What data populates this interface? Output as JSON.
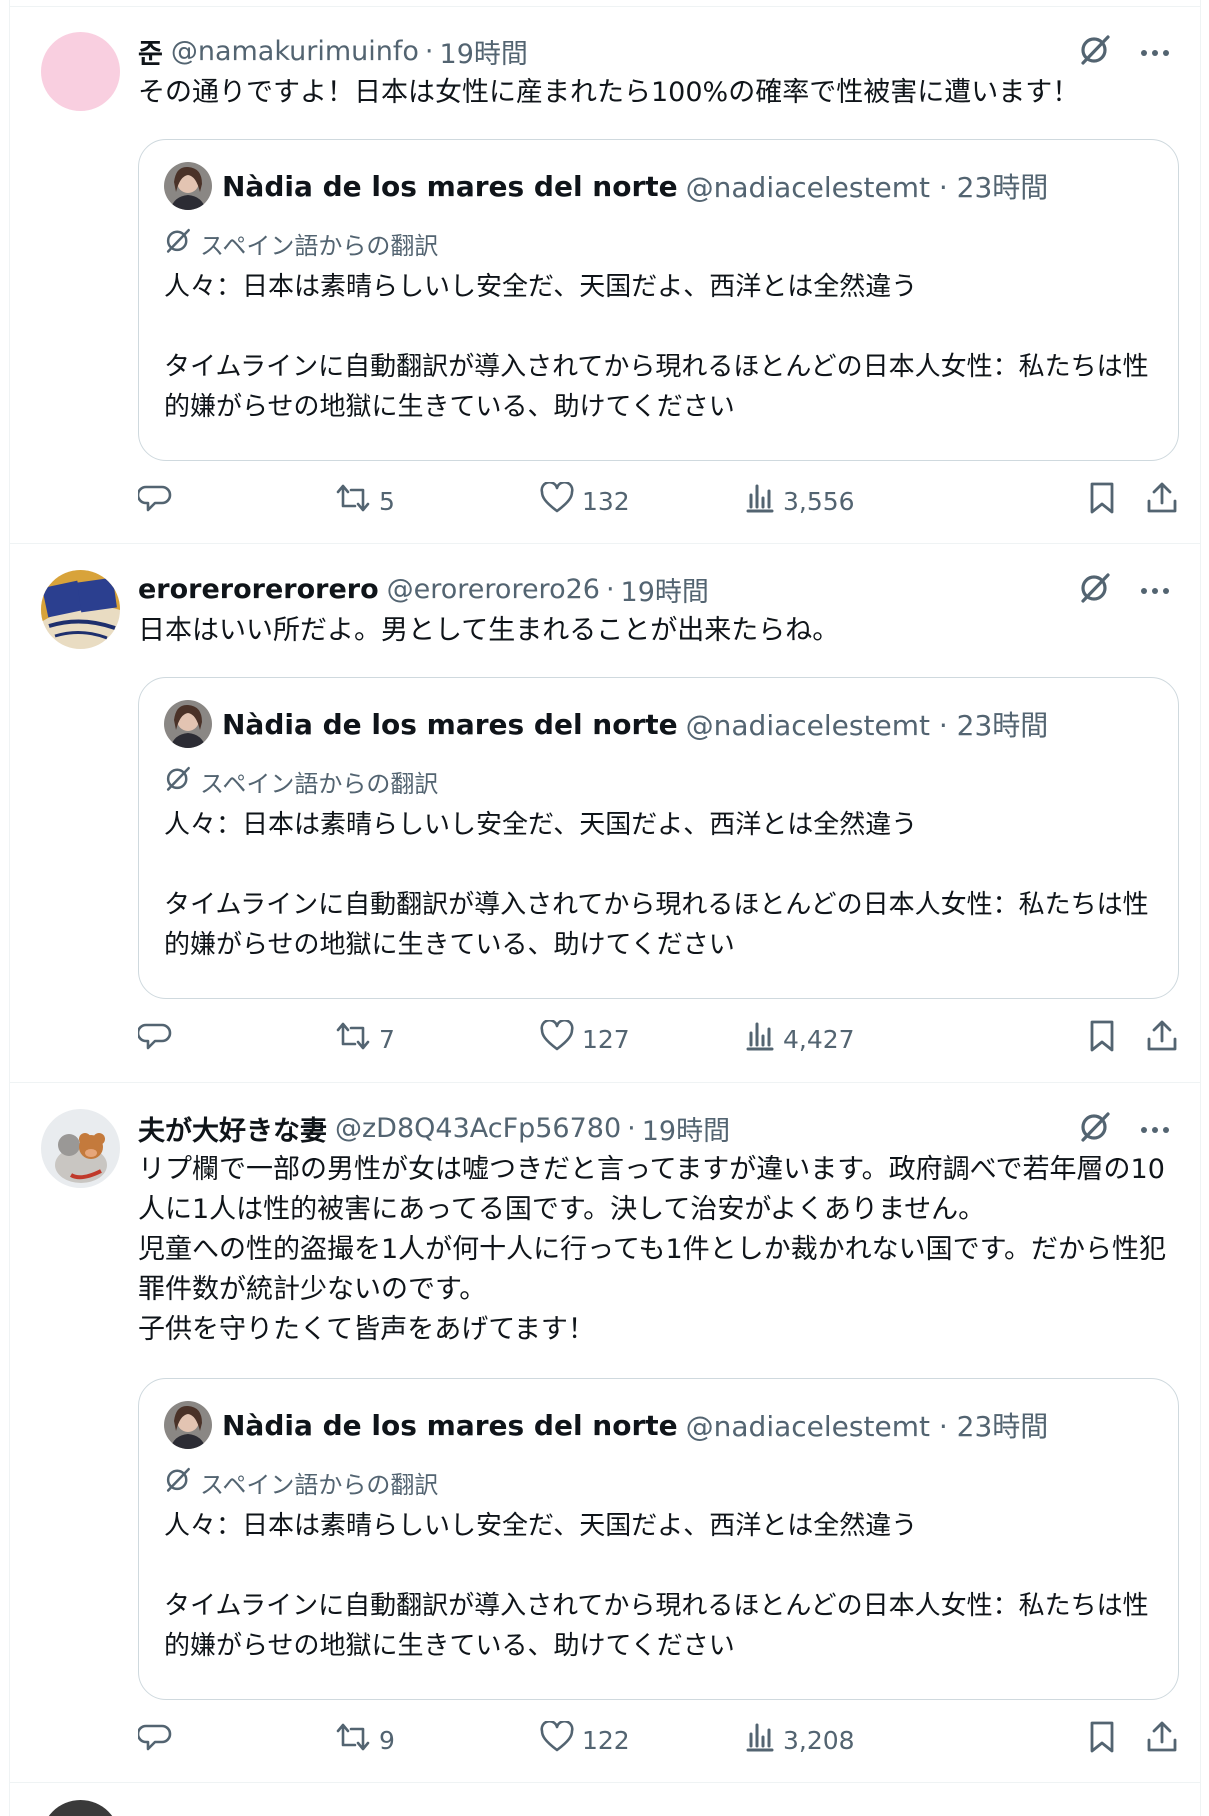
{
  "posts": [
    {
      "name": "준",
      "handle": "@namakurimuinfo",
      "time": "19時間",
      "text": "その通りですよ！日本は女性に産まれたら100%の確率で性被害に遭います！",
      "quote": {
        "name": "Nàdia de los mares del norte",
        "handle": "@nadiacelestemt · 23時間",
        "translation": "スペイン語からの翻訳",
        "line1": "人々：日本は素晴らしいし安全だ、天国だよ、西洋とは全然違う",
        "line2": "タイムラインに自動翻訳が導入されてから現れるほとんどの日本人女性：私たちは性的嫌がらせの地獄に生きている、助けてください"
      },
      "retweets": "5",
      "likes": "132",
      "views": "3,556"
    },
    {
      "name": "erorerorerorero",
      "handle": "@erorerorero26",
      "time": "19時間",
      "text": "日本はいい所だよ。男として生まれることが出来たらね。",
      "quote": {
        "name": "Nàdia de los mares del norte",
        "handle": "@nadiacelestemt · 23時間",
        "translation": "スペイン語からの翻訳",
        "line1": "人々：日本は素晴らしいし安全だ、天国だよ、西洋とは全然違う",
        "line2": "タイムラインに自動翻訳が導入されてから現れるほとんどの日本人女性：私たちは性的嫌がらせの地獄に生きている、助けてください"
      },
      "retweets": "7",
      "likes": "127",
      "views": "4,427"
    },
    {
      "name": "夫が大好きな妻",
      "handle": "@zD8Q43AcFp56780",
      "time": "19時間",
      "text": "リプ欄で一部の男性が女は嘘つきだと言ってますが違います。政府調べで若年層の10人に1人は性的被害にあってる国です。決して治安がよくありません。\n児童への性的盗撮を1人が何十人に行っても1件としか裁かれない国です。だから性犯罪件数が統計少ないのです。\n子供を守りたくて皆声をあげてます！",
      "quote": {
        "name": "Nàdia de los mares del norte",
        "handle": "@nadiacelestemt · 23時間",
        "translation": "スペイン語からの翻訳",
        "line1": "人々：日本は素晴らしいし安全だ、天国だよ、西洋とは全然違う",
        "line2": "タイムラインに自動翻訳が導入されてから現れるほとんどの日本人女性：私たちは性的嫌がらせの地獄に生きている、助けてください"
      },
      "retweets": "9",
      "likes": "122",
      "views": "3,208"
    }
  ],
  "colors": {
    "text": "#0f1419",
    "secondary": "#536471",
    "border": "#cfd9de",
    "avatar_pink": "#f9cfe0"
  },
  "icons": [
    "grok-icon",
    "more-icon",
    "reply-icon",
    "retweet-icon",
    "like-icon",
    "views-icon",
    "bookmark-icon",
    "share-icon",
    "translate-icon"
  ]
}
